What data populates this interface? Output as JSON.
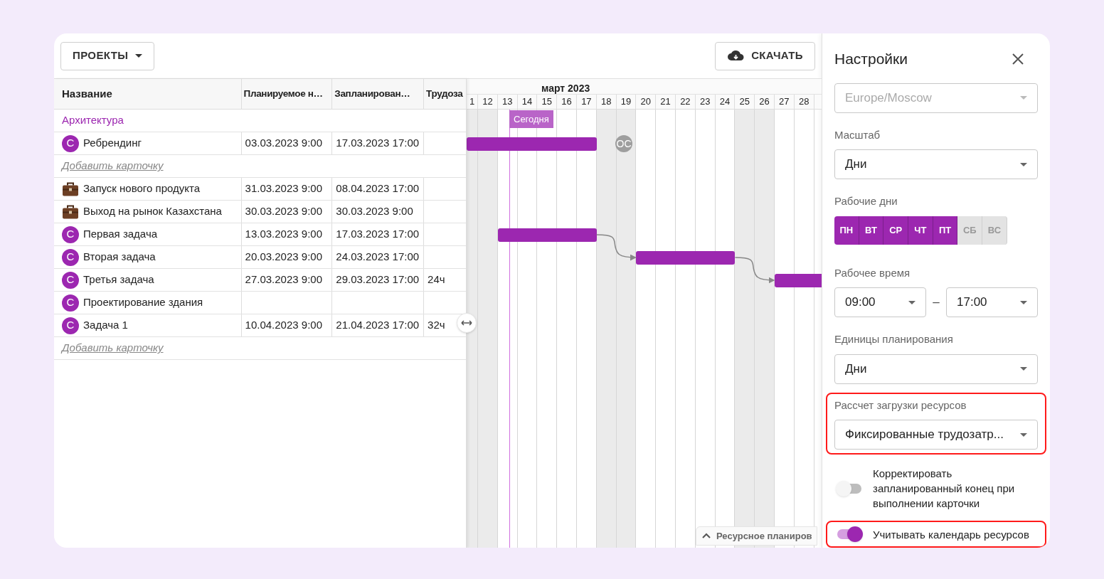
{
  "toolbar": {
    "projects_button": "ПРОЕКТЫ",
    "download_button": "СКАЧАТЬ"
  },
  "table": {
    "columns": [
      "Название",
      "Планируемое н…",
      "Запланирован…",
      "Трудоза"
    ],
    "rows": [
      {
        "kind": "group",
        "name": "Архитектура"
      },
      {
        "kind": "task",
        "avatar": "С",
        "name": "Ребрендинг",
        "cells": [
          "03.03.2023 9:00",
          "17.03.2023 17:00",
          ""
        ]
      },
      {
        "kind": "add",
        "name": "Добавить карточку"
      },
      {
        "kind": "project",
        "name": "Запуск нового продукта",
        "cells": [
          "31.03.2023 9:00",
          "08.04.2023 17:00",
          ""
        ]
      },
      {
        "kind": "project",
        "name": "Выход на рынок Казахстана",
        "cells": [
          "30.03.2023 9:00",
          "30.03.2023 9:00",
          ""
        ]
      },
      {
        "kind": "task",
        "avatar": "С",
        "name": "Первая задача",
        "cells": [
          "13.03.2023 9:00",
          "17.03.2023 17:00",
          ""
        ]
      },
      {
        "kind": "task",
        "avatar": "С",
        "name": "Вторая задача",
        "cells": [
          "20.03.2023 9:00",
          "24.03.2023 17:00",
          ""
        ]
      },
      {
        "kind": "task",
        "avatar": "С",
        "name": "Третья задача",
        "cells": [
          "27.03.2023 9:00",
          "29.03.2023 17:00",
          "24ч"
        ]
      },
      {
        "kind": "task",
        "avatar": "С",
        "name": "Проектирование здания",
        "cells": [
          "",
          "",
          ""
        ]
      },
      {
        "kind": "task",
        "avatar": "С",
        "name": "Задача 1",
        "cells": [
          "10.04.2023 9:00",
          "21.04.2023 17:00",
          "32ч"
        ]
      },
      {
        "kind": "add",
        "name": "Добавить карточку"
      }
    ]
  },
  "gantt": {
    "month": "март 2023",
    "today_label": "Сегодня",
    "marker": "ОС",
    "resource_tab": "Ресурсное планиров",
    "days": [
      {
        "label": "1",
        "weekend": true
      },
      {
        "label": "12",
        "weekend": true
      },
      {
        "label": "13",
        "weekend": false
      },
      {
        "label": "14",
        "weekend": false
      },
      {
        "label": "15",
        "weekend": false
      },
      {
        "label": "16",
        "weekend": false
      },
      {
        "label": "17",
        "weekend": false
      },
      {
        "label": "18",
        "weekend": true
      },
      {
        "label": "19",
        "weekend": true
      },
      {
        "label": "20",
        "weekend": false
      },
      {
        "label": "21",
        "weekend": false
      },
      {
        "label": "22",
        "weekend": false
      },
      {
        "label": "23",
        "weekend": false
      },
      {
        "label": "24",
        "weekend": false
      },
      {
        "label": "25",
        "weekend": true
      },
      {
        "label": "26",
        "weekend": true
      },
      {
        "label": "27",
        "weekend": false
      },
      {
        "label": "28",
        "weekend": false
      }
    ]
  },
  "settings": {
    "title": "Настройки",
    "timezone": {
      "value": "Europe/Moscow",
      "disabled": true
    },
    "scale": {
      "label": "Масштаб",
      "value": "Дни"
    },
    "workdays": {
      "label": "Рабочие дни",
      "days": [
        {
          "label": "ПН",
          "selected": true
        },
        {
          "label": "ВТ",
          "selected": true
        },
        {
          "label": "СР",
          "selected": true
        },
        {
          "label": "ЧТ",
          "selected": true
        },
        {
          "label": "ПТ",
          "selected": true
        },
        {
          "label": "СБ",
          "selected": false
        },
        {
          "label": "ВС",
          "selected": false
        }
      ]
    },
    "work_time": {
      "label": "Рабочее время",
      "from": "09:00",
      "separator": "–",
      "to": "17:00"
    },
    "units": {
      "label": "Единицы планирования",
      "value": "Дни"
    },
    "load_calc": {
      "label": "Рассчет загрузки ресурсов",
      "value": "Фиксированные трудозатр...",
      "highlighted": true
    },
    "toggles": [
      {
        "label": "Корректировать запланированный конец при выполнении карточки",
        "on": false,
        "highlighted": false
      },
      {
        "label": "Учитывать календарь ресурсов",
        "on": true,
        "highlighted": true
      }
    ]
  }
}
